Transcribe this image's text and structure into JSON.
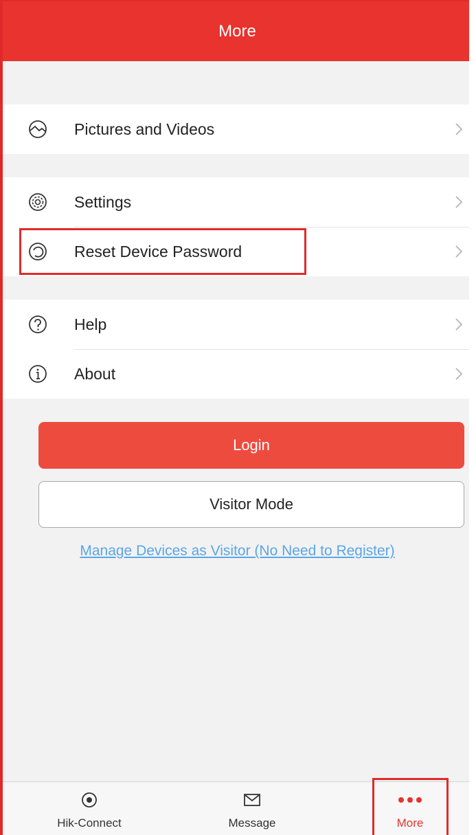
{
  "header": {
    "title": "More"
  },
  "menu": {
    "group1": [
      {
        "label": "Pictures and Videos",
        "icon": "pictures-icon"
      }
    ],
    "group2": [
      {
        "label": "Settings",
        "icon": "settings-icon"
      },
      {
        "label": "Reset Device Password",
        "icon": "reset-password-icon"
      }
    ],
    "group3": [
      {
        "label": "Help",
        "icon": "help-icon"
      },
      {
        "label": "About",
        "icon": "about-icon"
      }
    ]
  },
  "buttons": {
    "login": "Login",
    "visitor_mode": "Visitor Mode",
    "visitor_link": "Manage Devices as Visitor (No Need to Register)"
  },
  "tabbar": {
    "tabs": [
      {
        "label": "Hik-Connect",
        "icon": "hik-connect-icon",
        "active": false
      },
      {
        "label": "Message",
        "icon": "message-icon",
        "active": false
      },
      {
        "label": "More",
        "icon": "more-dots-icon",
        "active": true
      }
    ]
  },
  "colors": {
    "accent": "#e8332e",
    "link": "#5aa6e8",
    "highlight_box": "#e02a2a"
  }
}
